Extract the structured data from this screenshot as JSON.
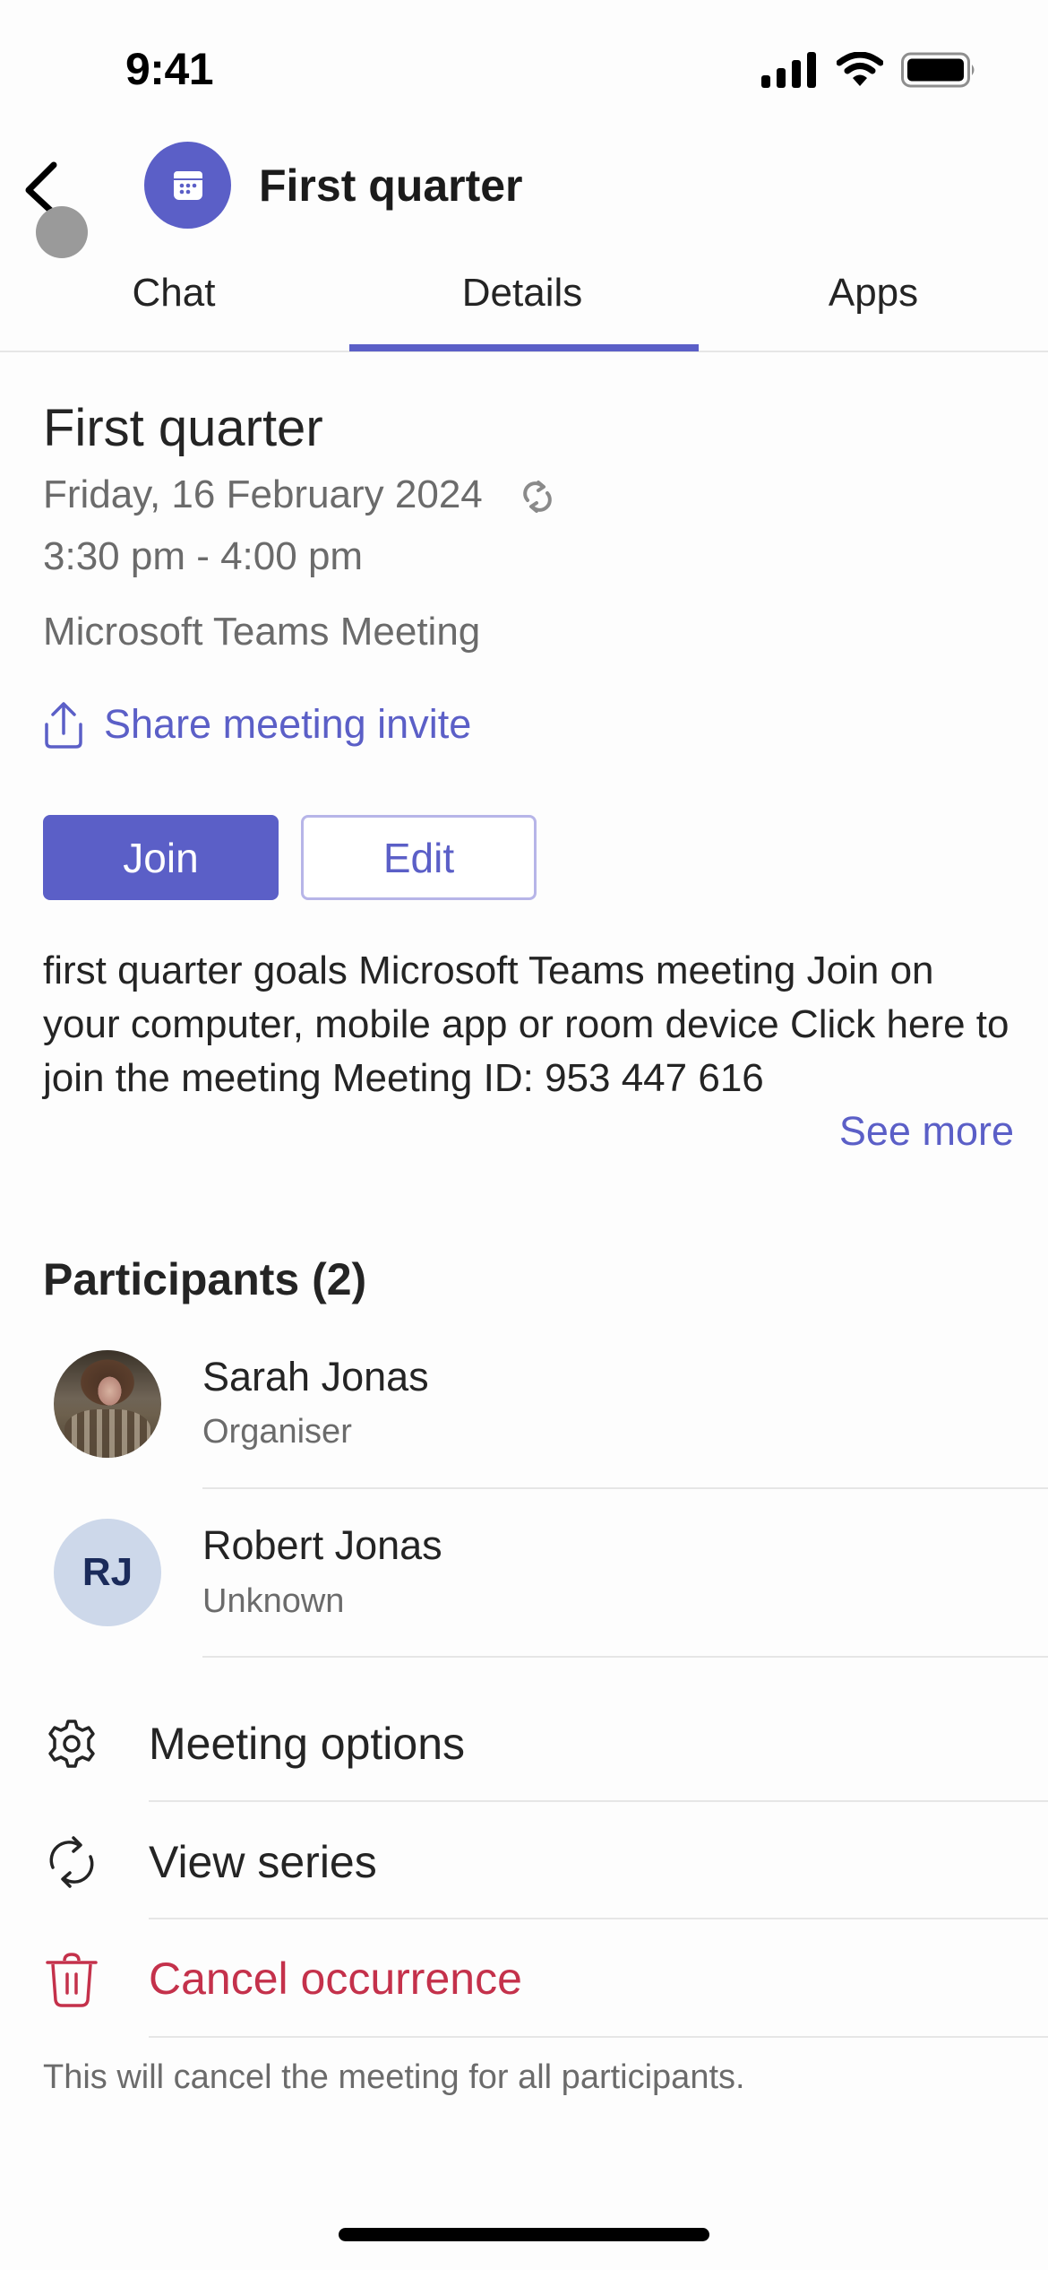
{
  "status_bar": {
    "time": "9:41",
    "icons": [
      "cellular-signal-icon",
      "wifi-icon",
      "battery-icon"
    ]
  },
  "header": {
    "back_icon": "chevron-left-icon",
    "avatar_icon": "calendar-icon",
    "title": "First quarter"
  },
  "tabs": [
    {
      "label": "Chat",
      "active": false
    },
    {
      "label": "Details",
      "active": true
    },
    {
      "label": "Apps",
      "active": false
    }
  ],
  "meeting": {
    "title": "First quarter",
    "date": "Friday, 16 February 2024",
    "recurring_icon": "recurring-icon",
    "time": "3:30 pm - 4:00 pm",
    "location": "Microsoft Teams Meeting",
    "share_label": "Share meeting invite"
  },
  "buttons": {
    "join": "Join",
    "edit": "Edit"
  },
  "description": {
    "text": "first quarter goals Microsoft Teams meeting Join on your computer, mobile app or room device Click here to join the meeting Meeting ID: 953 447 616",
    "see_more": "See more"
  },
  "participants": {
    "title": "Participants (2)",
    "items": [
      {
        "name": "Sarah Jonas",
        "role": "Organiser",
        "avatar": "photo"
      },
      {
        "name": "Robert Jonas",
        "role": "Unknown",
        "initials": "RJ"
      }
    ]
  },
  "actions": [
    {
      "label": "Meeting options",
      "icon": "gear-icon",
      "danger": false
    },
    {
      "label": "View series",
      "icon": "recurring-icon",
      "danger": false
    },
    {
      "label": "Cancel occurrence",
      "icon": "trash-icon",
      "danger": true
    }
  ],
  "footnote": "This will cancel the meeting for all participants.",
  "colors": {
    "brand": "#5b5fc7",
    "danger": "#c4314b",
    "secondary_text": "#6b6b6b",
    "initials_bg": "#cdd8ea",
    "initials_text": "#1b2b5b"
  }
}
